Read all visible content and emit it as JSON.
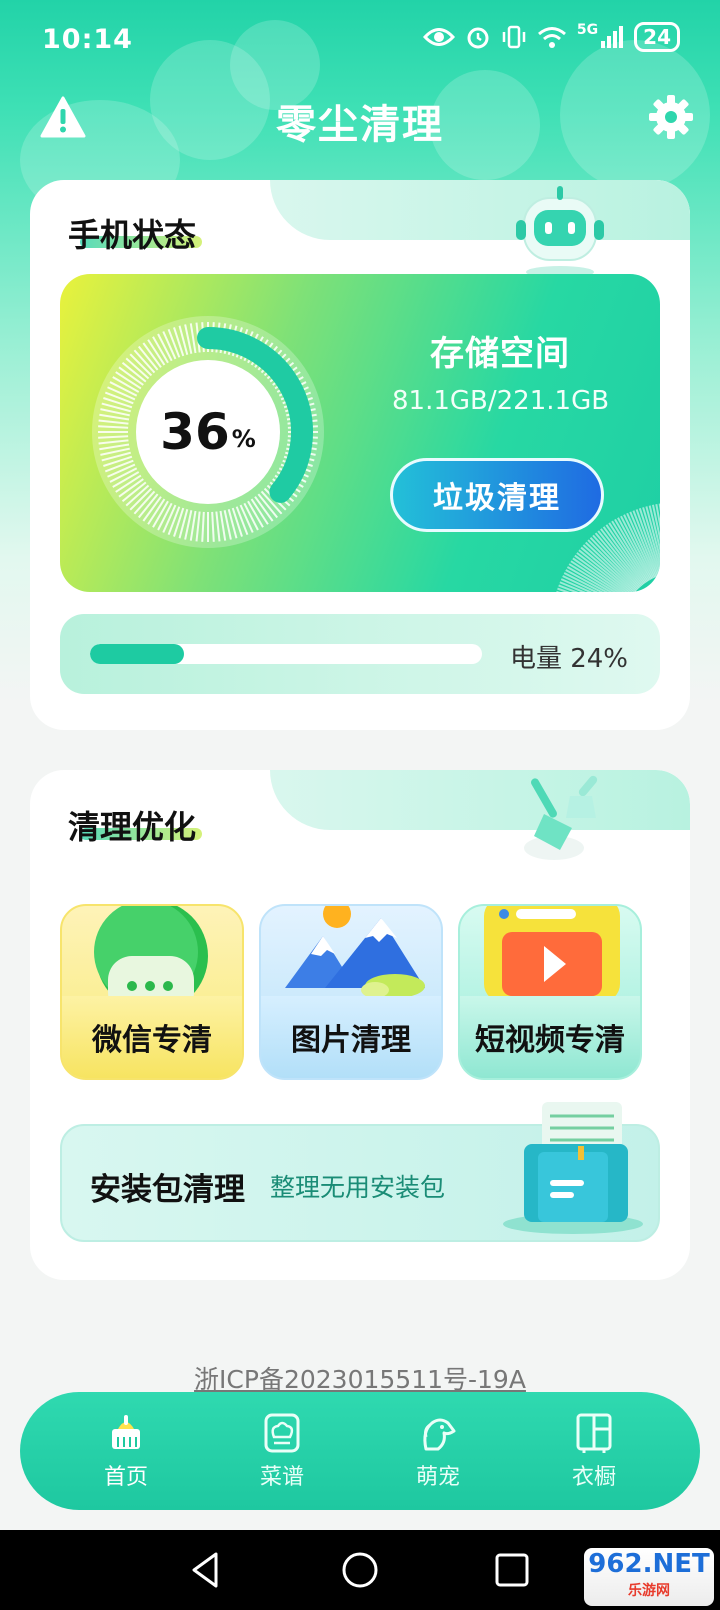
{
  "status_bar": {
    "time": "10:14",
    "network": "5G",
    "battery": "24"
  },
  "app_bar": {
    "title": "零尘清理",
    "left_icon": "warning-icon",
    "right_icon": "gear-icon"
  },
  "phone_status": {
    "section_title": "手机状态",
    "storage_percent": 36,
    "storage_percent_text": "36",
    "percent_sign": "%",
    "storage_title": "存储空间",
    "storage_value": "81.1GB/221.1GB",
    "clean_button": "垃圾清理",
    "battery_label": "电量  24%",
    "battery_level": 0.24
  },
  "clean_optimize": {
    "section_title": "清理优化",
    "tiles": [
      {
        "label": "微信专清",
        "icon": "wechat-chat-icon"
      },
      {
        "label": "图片清理",
        "icon": "mountain-picture-icon"
      },
      {
        "label": "短视频专清",
        "icon": "video-play-icon"
      }
    ],
    "apk": {
      "title": "安装包清理",
      "subtitle": "整理无用安装包",
      "icon": "folder-file-icon"
    }
  },
  "footer": {
    "icp": "浙ICP备2023015511号-19A"
  },
  "bottom_nav": {
    "items": [
      {
        "label": "首页",
        "icon": "broom-home-icon",
        "active": true
      },
      {
        "label": "菜谱",
        "icon": "chef-hat-icon",
        "active": false
      },
      {
        "label": "萌宠",
        "icon": "pet-dog-icon",
        "active": false
      },
      {
        "label": "衣橱",
        "icon": "wardrobe-icon",
        "active": false
      }
    ]
  },
  "watermark": {
    "top": "962.NET",
    "bottom": "乐游网"
  },
  "colors": {
    "brand": "#22d3a8",
    "accent_blue": "#1f6be2"
  }
}
